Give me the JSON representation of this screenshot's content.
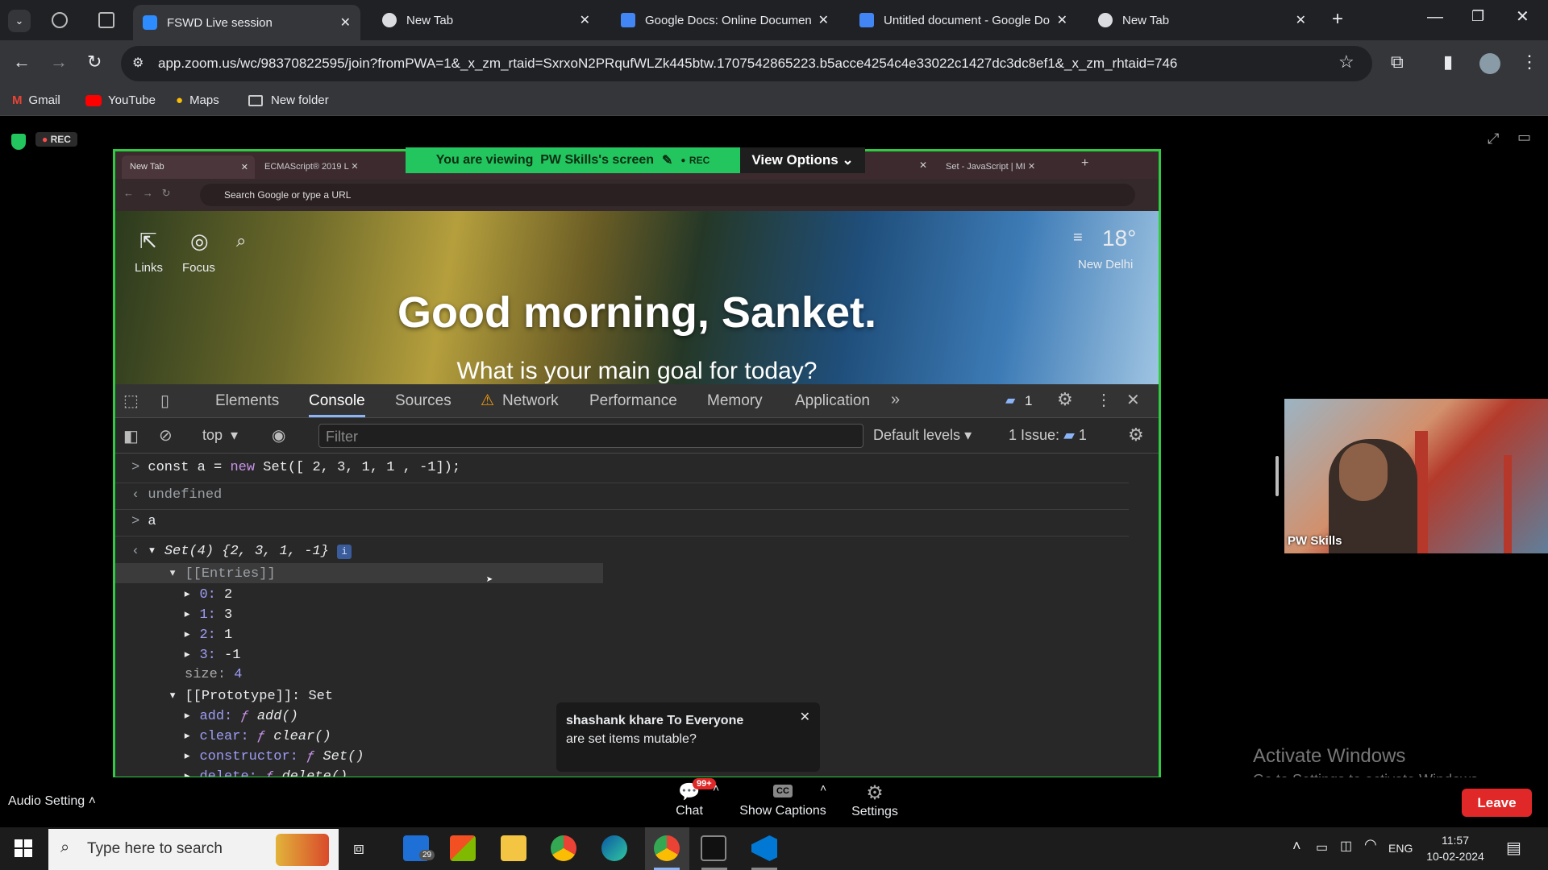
{
  "browser": {
    "tabs": [
      {
        "title": "FSWD Live session",
        "active": true
      },
      {
        "title": "New Tab",
        "active": false
      },
      {
        "title": "Google Docs: Online Document",
        "active": false
      },
      {
        "title": "Untitled document - Google Do",
        "active": false
      },
      {
        "title": "New Tab",
        "active": false
      }
    ],
    "url": "app.zoom.us/wc/98370822595/join?fromPWA=1&_x_zm_rtaid=SxrxoN2PRqufWLZk445btw.1707542865223.b5acce4254c4e33022c1427dc3dc8ef1&_x_zm_rhtaid=746",
    "bookmarks": [
      "Gmail",
      "YouTube",
      "Maps",
      "New folder"
    ]
  },
  "zoom": {
    "rec_label": "REC",
    "banner": "You are viewing  PW Skills's screen",
    "banner_rec": "REC",
    "view_options": "View Options",
    "participant_name": "PW Skills",
    "chat_popup": {
      "sender": "shashank khare To Everyone",
      "message": "are set items mutable?"
    },
    "watermark_title": "Activate Windows",
    "watermark_sub": "Go to Settings to activate Windows.",
    "bottom": {
      "audio_setting": "Audio Setting",
      "chat": "Chat",
      "chat_badge": "99+",
      "captions": "Show Captions",
      "captions_icon": "CC",
      "settings": "Settings",
      "leave": "Leave"
    }
  },
  "shared": {
    "inner_tabs": [
      "New Tab",
      "ECMAScript® 2019 L",
      "Set - JavaScript | MI"
    ],
    "inner_omni": "Search Google or type a URL",
    "links": "Links",
    "focus": "Focus",
    "temperature": "18°",
    "city": "New Delhi",
    "greeting": "Good morning, Sanket.",
    "goal": "What is your main goal for today?",
    "devtools": {
      "tabs": [
        "Elements",
        "Console",
        "Sources",
        "Network",
        "Performance",
        "Memory",
        "Application"
      ],
      "issue_count": "1",
      "context": "top",
      "filter_placeholder": "Filter",
      "levels": "Default levels",
      "issues_label": "1 Issue:",
      "issues_num": "1",
      "console": {
        "cmd1_a": "const a = ",
        "cmd1_new": "new",
        "cmd1_b": " Set([ 2, 3, 1, 1 , -1]);",
        "out1": "undefined",
        "cmd2": "a",
        "set_head": "Set(4) {2, 3, 1, -1}",
        "entries": "[[Entries]]",
        "items": [
          {
            "k": "0",
            "v": "2"
          },
          {
            "k": "1",
            "v": "3"
          },
          {
            "k": "2",
            "v": "1"
          },
          {
            "k": "3",
            "v": "-1"
          }
        ],
        "size_k": "size",
        "size_v": "4",
        "proto": "[[Prototype]]: Set",
        "methods": [
          {
            "k": "add",
            "v": "add()"
          },
          {
            "k": "clear",
            "v": "clear()"
          },
          {
            "k": "constructor",
            "v": "Set()"
          },
          {
            "k": "delete",
            "v": "delete()"
          }
        ]
      }
    }
  },
  "taskbar": {
    "search_placeholder": "Type here to search",
    "mail_badge": "29",
    "lang": "ENG",
    "time": "11:57",
    "date": "10-02-2024"
  },
  "colors": {
    "accent_green": "#22c55e",
    "leave_red": "#e02828",
    "chrome_dark": "#202124"
  }
}
